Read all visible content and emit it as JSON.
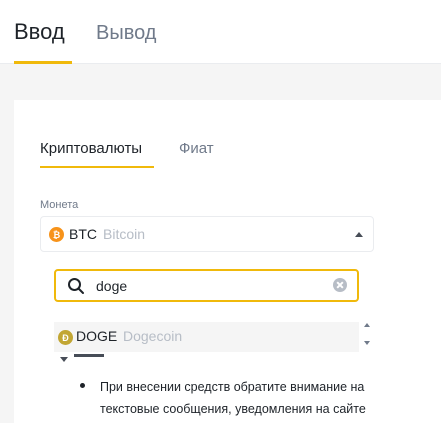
{
  "top_tabs": [
    {
      "label": "Ввод",
      "active": true
    },
    {
      "label": "Вывод",
      "active": false
    }
  ],
  "sub_tabs": [
    {
      "label": "Криптовалюты",
      "active": true
    },
    {
      "label": "Фиат",
      "active": false
    }
  ],
  "coin_select": {
    "label": "Монета",
    "selected_ticker": "BTC",
    "selected_name": "Bitcoin",
    "icon": "bitcoin-icon",
    "state": "open"
  },
  "search": {
    "value": "doge",
    "icon": "search-icon"
  },
  "results": [
    {
      "ticker": "DOGE",
      "name": "Dogecoin",
      "icon": "dogecoin-icon"
    }
  ],
  "notice": {
    "text": "При внесении средств обратите внимание на текстовые сообщения, уведомления на сайте"
  },
  "colors": {
    "accent": "#f0b90b",
    "btc": "#f7931a",
    "doge": "#c2a633",
    "text_primary": "#1e2329",
    "text_secondary": "#707a8a",
    "text_muted": "#b7bdc6"
  }
}
